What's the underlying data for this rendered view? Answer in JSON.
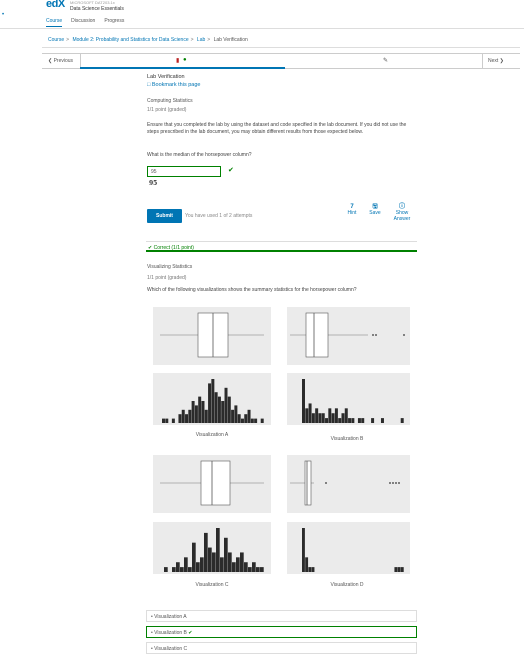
{
  "header": {
    "logo": "edX",
    "org": "MICROSOFT DAT203.1x",
    "course_title": "Data Science Essentials"
  },
  "tabs": [
    {
      "label": "Course",
      "active": true
    },
    {
      "label": "Discussion",
      "active": false
    },
    {
      "label": "Progress",
      "active": false
    }
  ],
  "breadcrumb": [
    "Course",
    "Module 2: Probability and Statistics for Data Science",
    "Lab",
    "Lab Verification"
  ],
  "sequence_nav": {
    "previous": "Previous",
    "next": "Next"
  },
  "unit": {
    "title": "Lab Verification",
    "bookmark": "Bookmark this page"
  },
  "problem1": {
    "title": "Computing Statistics",
    "points": "1/1 point (graded)",
    "instructions": "Ensure that you completed the lab by using the dataset and code specified in the lab document. If you did not use the steps prescribed in the lab document, you may obtain different results from those expected below.",
    "question": "What is the median of the horsepower column?",
    "answer_value": "95",
    "answer_echo": "95",
    "submit_label": "Submit",
    "attempts": "You have used 1 of 2 attempts",
    "hint_count": "7",
    "hint_label": "Hint",
    "save_label": "Save",
    "show_answer_label": "Show Answer",
    "feedback": "Correct (1/1 point)"
  },
  "problem2": {
    "title": "Visualizing Statistics",
    "points": "1/1 point (graded)",
    "question": "Which of the following visualizations shows the summary statistics for the horsepower column?",
    "captions": [
      "Visualization A",
      "Visualization B",
      "Visualization C",
      "Visualization D"
    ],
    "options": [
      {
        "label": "Visualization A",
        "selected": false
      },
      {
        "label": "Visualization B",
        "selected": true
      },
      {
        "label": "Visualization C",
        "selected": false
      }
    ]
  },
  "hist_heights": {
    "A": [
      1,
      1,
      0,
      1,
      0,
      2,
      3,
      2,
      3,
      5,
      4,
      6,
      5,
      3,
      9,
      10,
      7,
      6,
      5,
      8,
      6,
      3,
      4,
      2,
      1,
      2,
      3,
      1,
      1,
      0,
      1
    ],
    "B": [
      9,
      3,
      4,
      2,
      3,
      2,
      2,
      1,
      3,
      2,
      3,
      1,
      2,
      3,
      1,
      1,
      0,
      1,
      1,
      0,
      0,
      1,
      0,
      0,
      1,
      0,
      0,
      0,
      0,
      0,
      1
    ],
    "C": [
      1,
      0,
      1,
      2,
      1,
      3,
      1,
      6,
      2,
      3,
      8,
      5,
      4,
      9,
      3,
      7,
      4,
      2,
      3,
      4,
      2,
      1,
      2,
      1,
      1
    ],
    "D": [
      9,
      3,
      1,
      1,
      0,
      0,
      0,
      0,
      0,
      0,
      0,
      0,
      0,
      0,
      0,
      0,
      0,
      0,
      0,
      0,
      0,
      0,
      0,
      0,
      0,
      0,
      0,
      0,
      0,
      1,
      1,
      1
    ]
  },
  "colors": {
    "accent": "#0075b4",
    "success": "#008100",
    "bar": "#2b2b2b",
    "panel": "#ebebeb"
  }
}
